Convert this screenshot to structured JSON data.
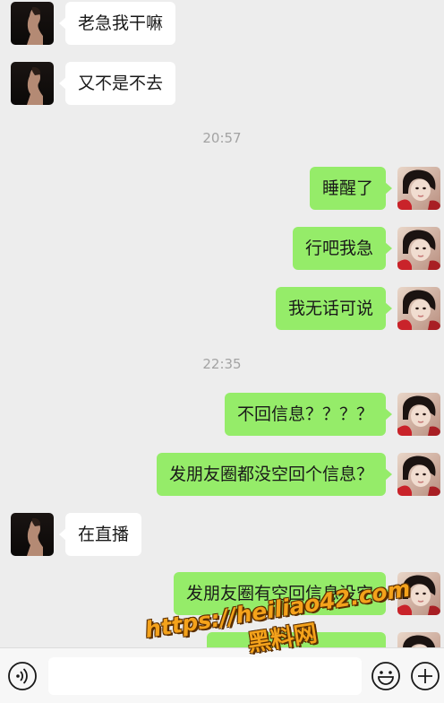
{
  "messages": [
    {
      "side": "in",
      "text": "老急我干嘛"
    },
    {
      "side": "in",
      "text": "又不是不去"
    },
    {
      "side": "out",
      "text": "睡醒了"
    },
    {
      "side": "out",
      "text": "行吧我急"
    },
    {
      "side": "out",
      "text": "我无话可说"
    },
    {
      "side": "out",
      "text": "不回信息？？？？"
    },
    {
      "side": "out",
      "text": "发朋友圈都没空回个信息？"
    },
    {
      "side": "in",
      "text": "在直播"
    },
    {
      "side": "out",
      "text": "发朋友圈有空回信息没空"
    }
  ],
  "timestamps": [
    "20:57",
    "22:35"
  ],
  "watermark": {
    "url": "https://heiliao42.com",
    "name": "黑料网"
  },
  "input_bar": {
    "icons": [
      "voice-icon",
      "emoji-icon",
      "plus-icon"
    ],
    "input_value": ""
  },
  "colors": {
    "background": "#ededed",
    "incoming_bubble": "#ffffff",
    "outgoing_bubble": "#95ec69",
    "timestamp": "#a3a3a3",
    "watermark": "#f4a21b"
  }
}
